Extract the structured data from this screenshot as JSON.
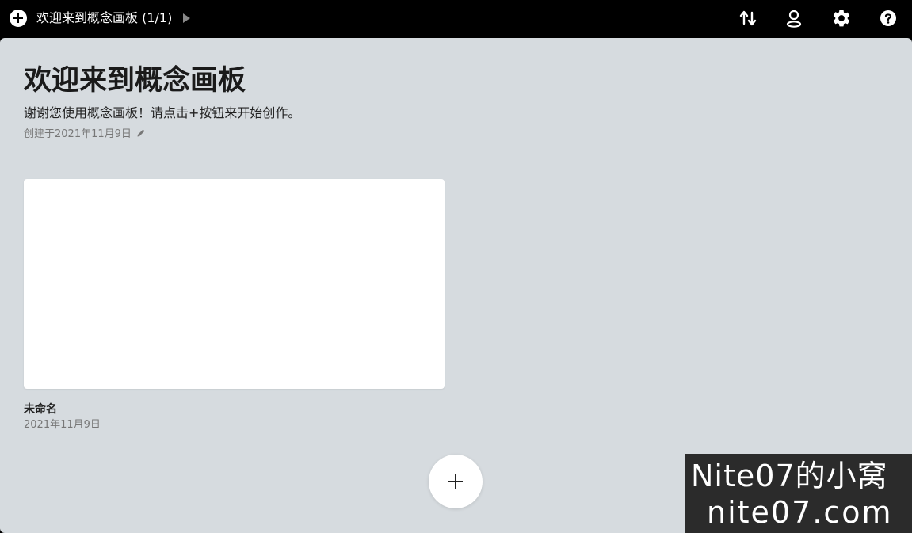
{
  "header": {
    "board_title": "欢迎来到概念画板 (1/1)",
    "icons": {
      "add": "add-circle-icon",
      "board_menu": "caret-right-icon",
      "sort": "sort-arrows-icon",
      "account": "account-icon",
      "settings": "gear-icon",
      "help": "help-icon"
    }
  },
  "board": {
    "title": "欢迎来到概念画板",
    "description": "谢谢您使用概念画板！请点击+按钮来开始创作。",
    "created": "创建于2021年11月9日",
    "background_color": "#d6dbdf"
  },
  "cards": [
    {
      "name": "未命名",
      "date": "2021年11月9日"
    }
  ],
  "fab": {
    "icon": "plus-icon"
  },
  "watermark": {
    "line1": "Nite07的小窝",
    "line2": "nite07.com"
  }
}
